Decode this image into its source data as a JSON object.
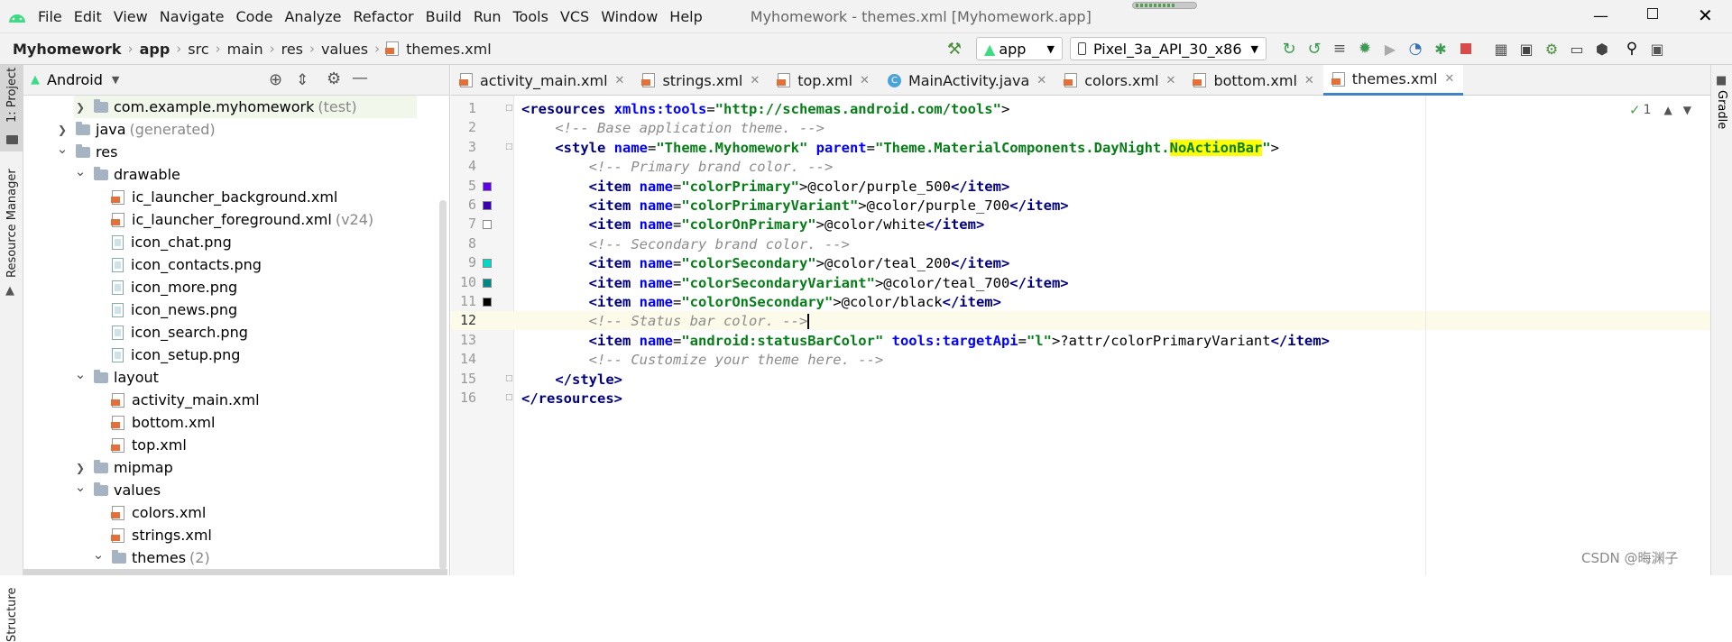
{
  "menu": [
    "File",
    "Edit",
    "View",
    "Navigate",
    "Code",
    "Analyze",
    "Refactor",
    "Build",
    "Run",
    "Tools",
    "VCS",
    "Window",
    "Help"
  ],
  "window_title": "Myhomework - themes.xml [Myhomework.app]",
  "breadcrumb": [
    "Myhomework",
    "app",
    "src",
    "main",
    "res",
    "values",
    "themes.xml"
  ],
  "toolbar": {
    "config": "app",
    "device": "Pixel_3a_API_30_x86"
  },
  "side": {
    "project": "1: Project",
    "resource_manager": "Resource Manager",
    "structure": "Structure",
    "gradle": "Gradle"
  },
  "project_panel": {
    "view": "Android"
  },
  "tree": [
    {
      "indent": 1,
      "arrow": "right",
      "icon": "folder",
      "label": "com.example.myhomework",
      "suffix": "(test)"
    },
    {
      "indent": 0,
      "arrow": "right",
      "icon": "folder",
      "label": "java",
      "suffix": "(generated)"
    },
    {
      "indent": 0,
      "arrow": "down",
      "icon": "folder",
      "label": "res",
      "suffix": ""
    },
    {
      "indent": 1,
      "arrow": "down",
      "icon": "folder",
      "label": "drawable",
      "suffix": ""
    },
    {
      "indent": 2,
      "arrow": "",
      "icon": "xml",
      "label": "ic_launcher_background.xml",
      "suffix": ""
    },
    {
      "indent": 2,
      "arrow": "",
      "icon": "xml",
      "label": "ic_launcher_foreground.xml",
      "suffix": "(v24)"
    },
    {
      "indent": 2,
      "arrow": "",
      "icon": "png",
      "label": "icon_chat.png",
      "suffix": ""
    },
    {
      "indent": 2,
      "arrow": "",
      "icon": "png",
      "label": "icon_contacts.png",
      "suffix": ""
    },
    {
      "indent": 2,
      "arrow": "",
      "icon": "png",
      "label": "icon_more.png",
      "suffix": ""
    },
    {
      "indent": 2,
      "arrow": "",
      "icon": "png",
      "label": "icon_news.png",
      "suffix": ""
    },
    {
      "indent": 2,
      "arrow": "",
      "icon": "png",
      "label": "icon_search.png",
      "suffix": ""
    },
    {
      "indent": 2,
      "arrow": "",
      "icon": "png",
      "label": "icon_setup.png",
      "suffix": ""
    },
    {
      "indent": 1,
      "arrow": "down",
      "icon": "folder",
      "label": "layout",
      "suffix": ""
    },
    {
      "indent": 2,
      "arrow": "",
      "icon": "xml",
      "label": "activity_main.xml",
      "suffix": ""
    },
    {
      "indent": 2,
      "arrow": "",
      "icon": "xml",
      "label": "bottom.xml",
      "suffix": ""
    },
    {
      "indent": 2,
      "arrow": "",
      "icon": "xml",
      "label": "top.xml",
      "suffix": ""
    },
    {
      "indent": 1,
      "arrow": "right",
      "icon": "folder",
      "label": "mipmap",
      "suffix": ""
    },
    {
      "indent": 1,
      "arrow": "down",
      "icon": "folder",
      "label": "values",
      "suffix": ""
    },
    {
      "indent": 2,
      "arrow": "",
      "icon": "xml",
      "label": "colors.xml",
      "suffix": ""
    },
    {
      "indent": 2,
      "arrow": "",
      "icon": "xml",
      "label": "strings.xml",
      "suffix": ""
    },
    {
      "indent": 2,
      "arrow": "down",
      "icon": "folder",
      "label": "themes",
      "suffix": "(2)"
    }
  ],
  "tabs": [
    {
      "label": "activity_main.xml",
      "icon": "xml"
    },
    {
      "label": "strings.xml",
      "icon": "xml"
    },
    {
      "label": "top.xml",
      "icon": "xml"
    },
    {
      "label": "MainActivity.java",
      "icon": "class"
    },
    {
      "label": "colors.xml",
      "icon": "xml"
    },
    {
      "label": "bottom.xml",
      "icon": "xml"
    },
    {
      "label": "themes.xml",
      "icon": "xml",
      "active": true
    }
  ],
  "inspection_count": "1",
  "code": [
    {
      "n": "1",
      "swatch": "",
      "tokens": [
        [
          "tg",
          "<resources "
        ],
        [
          "at",
          "xmlns:tools"
        ],
        [
          "",
          "="
        ],
        [
          "st",
          "\"http://schemas.android.com/tools\""
        ],
        [
          "",
          ">"
        ]
      ]
    },
    {
      "n": "2",
      "swatch": "",
      "tokens": [
        [
          "",
          "    "
        ],
        [
          "cm",
          "<!-- Base application theme. -->"
        ]
      ]
    },
    {
      "n": "3",
      "swatch": "",
      "tokens": [
        [
          "",
          "    "
        ],
        [
          "tg",
          "<style "
        ],
        [
          "at",
          "name"
        ],
        [
          "",
          "="
        ],
        [
          "st",
          "\"Theme.Myhomework\" "
        ],
        [
          "at",
          "parent"
        ],
        [
          "",
          "="
        ],
        [
          "st",
          "\"Theme.MaterialComponents.DayNight."
        ],
        [
          "hl",
          "NoActionBar"
        ],
        [
          "st",
          "\""
        ],
        [
          "",
          ">"
        ]
      ]
    },
    {
      "n": "4",
      "swatch": "",
      "tokens": [
        [
          "",
          "        "
        ],
        [
          "cm",
          "<!-- Primary brand color. -->"
        ]
      ]
    },
    {
      "n": "5",
      "swatch": "#6200ee",
      "tokens": [
        [
          "",
          "        "
        ],
        [
          "tg",
          "<item "
        ],
        [
          "at",
          "name"
        ],
        [
          "",
          "="
        ],
        [
          "st",
          "\"colorPrimary\""
        ],
        [
          "",
          ">@color/purple_500"
        ],
        [
          "tg",
          "</item>"
        ]
      ]
    },
    {
      "n": "6",
      "swatch": "#3700b3",
      "tokens": [
        [
          "",
          "        "
        ],
        [
          "tg",
          "<item "
        ],
        [
          "at",
          "name"
        ],
        [
          "",
          "="
        ],
        [
          "st",
          "\"colorPrimaryVariant\""
        ],
        [
          "",
          ">@color/purple_700"
        ],
        [
          "tg",
          "</item>"
        ]
      ]
    },
    {
      "n": "7",
      "swatch": "#ffffff",
      "tokens": [
        [
          "",
          "        "
        ],
        [
          "tg",
          "<item "
        ],
        [
          "at",
          "name"
        ],
        [
          "",
          "="
        ],
        [
          "st",
          "\"colorOnPrimary\""
        ],
        [
          "",
          ">@color/white"
        ],
        [
          "tg",
          "</item>"
        ]
      ]
    },
    {
      "n": "8",
      "swatch": "",
      "tokens": [
        [
          "",
          "        "
        ],
        [
          "cm",
          "<!-- Secondary brand color. -->"
        ]
      ]
    },
    {
      "n": "9",
      "swatch": "#03dac5",
      "tokens": [
        [
          "",
          "        "
        ],
        [
          "tg",
          "<item "
        ],
        [
          "at",
          "name"
        ],
        [
          "",
          "="
        ],
        [
          "st",
          "\"colorSecondary\""
        ],
        [
          "",
          ">@color/teal_200"
        ],
        [
          "tg",
          "</item>"
        ]
      ]
    },
    {
      "n": "10",
      "swatch": "#018786",
      "tokens": [
        [
          "",
          "        "
        ],
        [
          "tg",
          "<item "
        ],
        [
          "at",
          "name"
        ],
        [
          "",
          "="
        ],
        [
          "st",
          "\"colorSecondaryVariant\""
        ],
        [
          "",
          ">@color/teal_700"
        ],
        [
          "tg",
          "</item>"
        ]
      ]
    },
    {
      "n": "11",
      "swatch": "#000000",
      "tokens": [
        [
          "",
          "        "
        ],
        [
          "tg",
          "<item "
        ],
        [
          "at",
          "name"
        ],
        [
          "",
          "="
        ],
        [
          "st",
          "\"colorOnSecondary\""
        ],
        [
          "",
          ">@color/black"
        ],
        [
          "tg",
          "</item>"
        ]
      ]
    },
    {
      "n": "12",
      "swatch": "",
      "current": true,
      "tokens": [
        [
          "",
          "        "
        ],
        [
          "cm",
          "<!-- Status bar color. -->"
        ]
      ]
    },
    {
      "n": "13",
      "swatch": "",
      "tokens": [
        [
          "",
          "        "
        ],
        [
          "tg",
          "<item "
        ],
        [
          "at",
          "name"
        ],
        [
          "",
          "="
        ],
        [
          "st",
          "\"android:statusBarColor\" "
        ],
        [
          "at",
          "tools:targetApi"
        ],
        [
          "",
          "="
        ],
        [
          "st",
          "\"l\""
        ],
        [
          "",
          ">?attr/colorPrimaryVariant"
        ],
        [
          "tg",
          "</item>"
        ]
      ]
    },
    {
      "n": "14",
      "swatch": "",
      "tokens": [
        [
          "",
          "        "
        ],
        [
          "cm",
          "<!-- Customize your theme here. -->"
        ]
      ]
    },
    {
      "n": "15",
      "swatch": "",
      "tokens": [
        [
          "",
          "    "
        ],
        [
          "tg",
          "</style>"
        ]
      ]
    },
    {
      "n": "16",
      "swatch": "",
      "tokens": [
        [
          "tg",
          "</resources>"
        ]
      ]
    }
  ],
  "watermark": "CSDN @晦渊子"
}
